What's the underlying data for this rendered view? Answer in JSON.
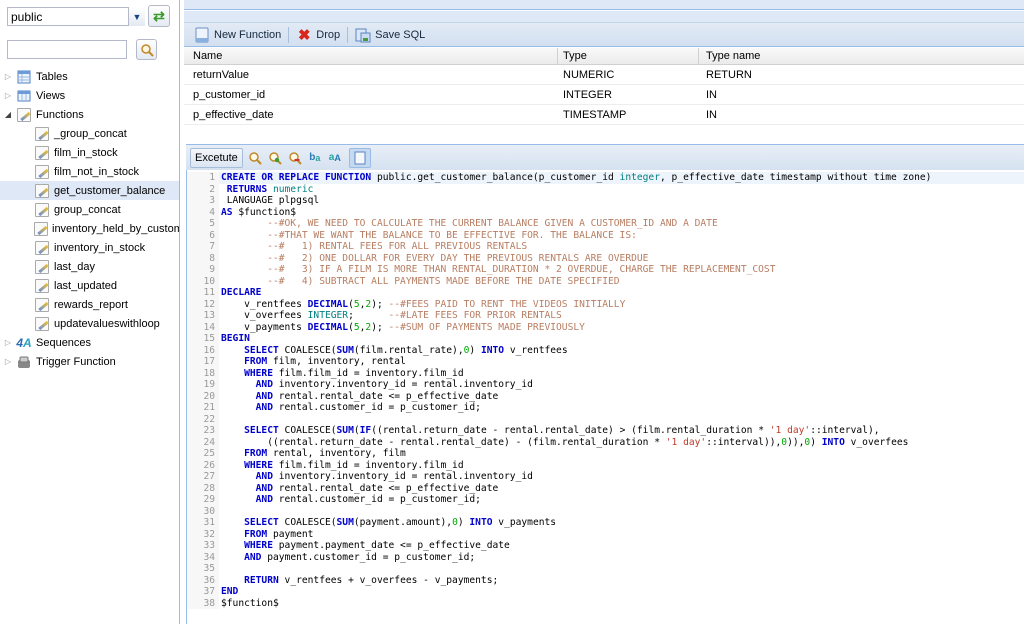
{
  "sidebar": {
    "schema_select": {
      "value": "public"
    },
    "search": {
      "value": "",
      "placeholder": ""
    },
    "tree": [
      {
        "label": "Tables",
        "expanded": false,
        "icon": "table-icon"
      },
      {
        "label": "Views",
        "expanded": false,
        "icon": "view-icon"
      },
      {
        "label": "Functions",
        "expanded": true,
        "icon": "function-icon",
        "children": [
          "_group_concat",
          "film_in_stock",
          "film_not_in_stock",
          "get_customer_balance",
          "group_concat",
          "inventory_held_by_custome",
          "inventory_in_stock",
          "last_day",
          "last_updated",
          "rewards_report",
          "updatevalueswithloop"
        ],
        "selected": "get_customer_balance"
      },
      {
        "label": "Sequences",
        "expanded": false,
        "icon": "sequence-icon"
      },
      {
        "label": "Trigger Function",
        "expanded": false,
        "icon": "trigger-icon"
      }
    ]
  },
  "toolbar": {
    "new_function": "New Function",
    "drop": "Drop",
    "save_sql": "Save SQL"
  },
  "params_grid": {
    "columns": [
      "Name",
      "Type",
      "Type name"
    ],
    "rows": [
      [
        "returnValue",
        "NUMERIC",
        "RETURN"
      ],
      [
        "p_customer_id",
        "INTEGER",
        "IN"
      ],
      [
        "p_effective_date",
        "TIMESTAMP",
        "IN"
      ]
    ]
  },
  "editor_toolbar": {
    "execute": "Excetute",
    "icons": [
      "search-icon",
      "zoom-in-icon",
      "zoom-out-icon",
      "replace-icon",
      "find-replace-icon",
      "wrap-toggle-icon"
    ]
  },
  "editor": {
    "active_line": 1,
    "lines": [
      [
        [
          "kw",
          "CREATE OR REPLACE FUNCTION "
        ],
        [
          "",
          "public.get_customer_balance(p_customer_id "
        ],
        [
          "ty",
          "integer"
        ],
        [
          "",
          ", p_effective_date timestamp without time zone)"
        ]
      ],
      [
        [
          "",
          ""
        ],
        [
          "kw",
          " RETURNS "
        ],
        [
          "ty",
          "numeric"
        ]
      ],
      [
        [
          "",
          ""
        ],
        [
          "",
          ""
        ],
        [
          "",
          " LANGUAGE plpgsql"
        ]
      ],
      [
        [
          "kw",
          "AS "
        ],
        [
          "",
          "$function$"
        ]
      ],
      [
        [
          "cm",
          "        --#OK, WE NEED TO CALCULATE THE CURRENT BALANCE GIVEN A CUSTOMER_ID AND A DATE"
        ]
      ],
      [
        [
          "cm",
          "        --#THAT WE WANT THE BALANCE TO BE EFFECTIVE FOR. THE BALANCE IS:"
        ]
      ],
      [
        [
          "cm",
          "        --#   1) RENTAL FEES FOR ALL PREVIOUS RENTALS"
        ]
      ],
      [
        [
          "cm",
          "        --#   2) ONE DOLLAR FOR EVERY DAY THE PREVIOUS RENTALS ARE OVERDUE"
        ]
      ],
      [
        [
          "cm",
          "        --#   3) IF A FILM IS MORE THAN RENTAL_DURATION * 2 OVERDUE, CHARGE THE REPLACEMENT_COST"
        ]
      ],
      [
        [
          "cm",
          "        --#   4) SUBTRACT ALL PAYMENTS MADE BEFORE THE DATE SPECIFIED"
        ]
      ],
      [
        [
          "kw",
          "DECLARE"
        ]
      ],
      [
        [
          "",
          "    v_rentfees "
        ],
        [
          "kw",
          "DECIMAL"
        ],
        [
          "",
          "("
        ],
        [
          "num",
          "5"
        ],
        [
          "",
          ","
        ],
        [
          "num",
          "2"
        ],
        [
          "",
          "); "
        ],
        [
          "cm",
          "--#FEES PAID TO RENT THE VIDEOS INITIALLY"
        ]
      ],
      [
        [
          "",
          "    v_overfees "
        ],
        [
          "ty",
          "INTEGER"
        ],
        [
          "",
          ";      "
        ],
        [
          "cm",
          "--#LATE FEES FOR PRIOR RENTALS"
        ]
      ],
      [
        [
          "",
          "    v_payments "
        ],
        [
          "kw",
          "DECIMAL"
        ],
        [
          "",
          "("
        ],
        [
          "num",
          "5"
        ],
        [
          "",
          ","
        ],
        [
          "num",
          "2"
        ],
        [
          "",
          "); "
        ],
        [
          "cm",
          "--#SUM OF PAYMENTS MADE PREVIOUSLY"
        ]
      ],
      [
        [
          "kw",
          "BEGIN"
        ]
      ],
      [
        [
          "kw",
          "    SELECT "
        ],
        [
          "",
          "COALESCE("
        ],
        [
          "kw",
          "SUM"
        ],
        [
          "",
          "(film.rental_rate),"
        ],
        [
          "num",
          "0"
        ],
        [
          "",
          ") "
        ],
        [
          "kw",
          "INTO"
        ],
        [
          "",
          " v_rentfees"
        ]
      ],
      [
        [
          "kw",
          "    FROM "
        ],
        [
          "",
          "film, inventory, rental"
        ]
      ],
      [
        [
          "kw",
          "    WHERE "
        ],
        [
          "",
          "film.film_id = inventory.film_id"
        ]
      ],
      [
        [
          "kw",
          "      AND "
        ],
        [
          "",
          "inventory.inventory_id = rental.inventory_id"
        ]
      ],
      [
        [
          "kw",
          "      AND "
        ],
        [
          "",
          "rental.rental_date <= p_effective_date"
        ]
      ],
      [
        [
          "kw",
          "      AND "
        ],
        [
          "",
          "rental.customer_id = p_customer_id;"
        ]
      ],
      [
        [
          "",
          ""
        ]
      ],
      [
        [
          "kw",
          "    SELECT "
        ],
        [
          "",
          "COALESCE("
        ],
        [
          "kw",
          "SUM"
        ],
        [
          "",
          "("
        ],
        [
          "kw",
          "IF"
        ],
        [
          "",
          "((rental.return_date - rental.rental_date) > (film.rental_duration * "
        ],
        [
          "str",
          "'1 day'"
        ],
        [
          "",
          "::interval),"
        ]
      ],
      [
        [
          "",
          "        ((rental.return_date - rental.rental_date) - (film.rental_duration * "
        ],
        [
          "str",
          "'1 day'"
        ],
        [
          "",
          "::interval)),"
        ],
        [
          "num",
          "0"
        ],
        [
          "",
          "))"
        ],
        [
          "",
          ","
        ],
        [
          "num",
          "0"
        ],
        [
          "",
          ") "
        ],
        [
          "kw",
          "INTO"
        ],
        [
          "",
          " v_overfees"
        ]
      ],
      [
        [
          "kw",
          "    FROM "
        ],
        [
          "",
          "rental, inventory, film"
        ]
      ],
      [
        [
          "kw",
          "    WHERE "
        ],
        [
          "",
          "film.film_id = inventory.film_id"
        ]
      ],
      [
        [
          "kw",
          "      AND "
        ],
        [
          "",
          "inventory.inventory_id = rental.inventory_id"
        ]
      ],
      [
        [
          "kw",
          "      AND "
        ],
        [
          "",
          "rental.rental_date <= p_effective_date"
        ]
      ],
      [
        [
          "kw",
          "      AND "
        ],
        [
          "",
          "rental.customer_id = p_customer_id;"
        ]
      ],
      [
        [
          "",
          ""
        ]
      ],
      [
        [
          "kw",
          "    SELECT "
        ],
        [
          "",
          "COALESCE("
        ],
        [
          "kw",
          "SUM"
        ],
        [
          "",
          "(payment.amount),"
        ],
        [
          "num",
          "0"
        ],
        [
          "",
          ") "
        ],
        [
          "kw",
          "INTO"
        ],
        [
          "",
          " v_payments"
        ]
      ],
      [
        [
          "kw",
          "    FROM "
        ],
        [
          "",
          "payment"
        ]
      ],
      [
        [
          "kw",
          "    WHERE "
        ],
        [
          "",
          "payment.payment_date <= p_effective_date"
        ]
      ],
      [
        [
          "kw",
          "    AND "
        ],
        [
          "",
          "payment.customer_id = p_customer_id;"
        ]
      ],
      [
        [
          "",
          ""
        ]
      ],
      [
        [
          "kw",
          "    RETURN "
        ],
        [
          "",
          "v_rentfees + v_overfees - v_payments;"
        ]
      ],
      [
        [
          "kw",
          "END"
        ]
      ],
      [
        [
          "",
          "$function$"
        ]
      ]
    ]
  }
}
